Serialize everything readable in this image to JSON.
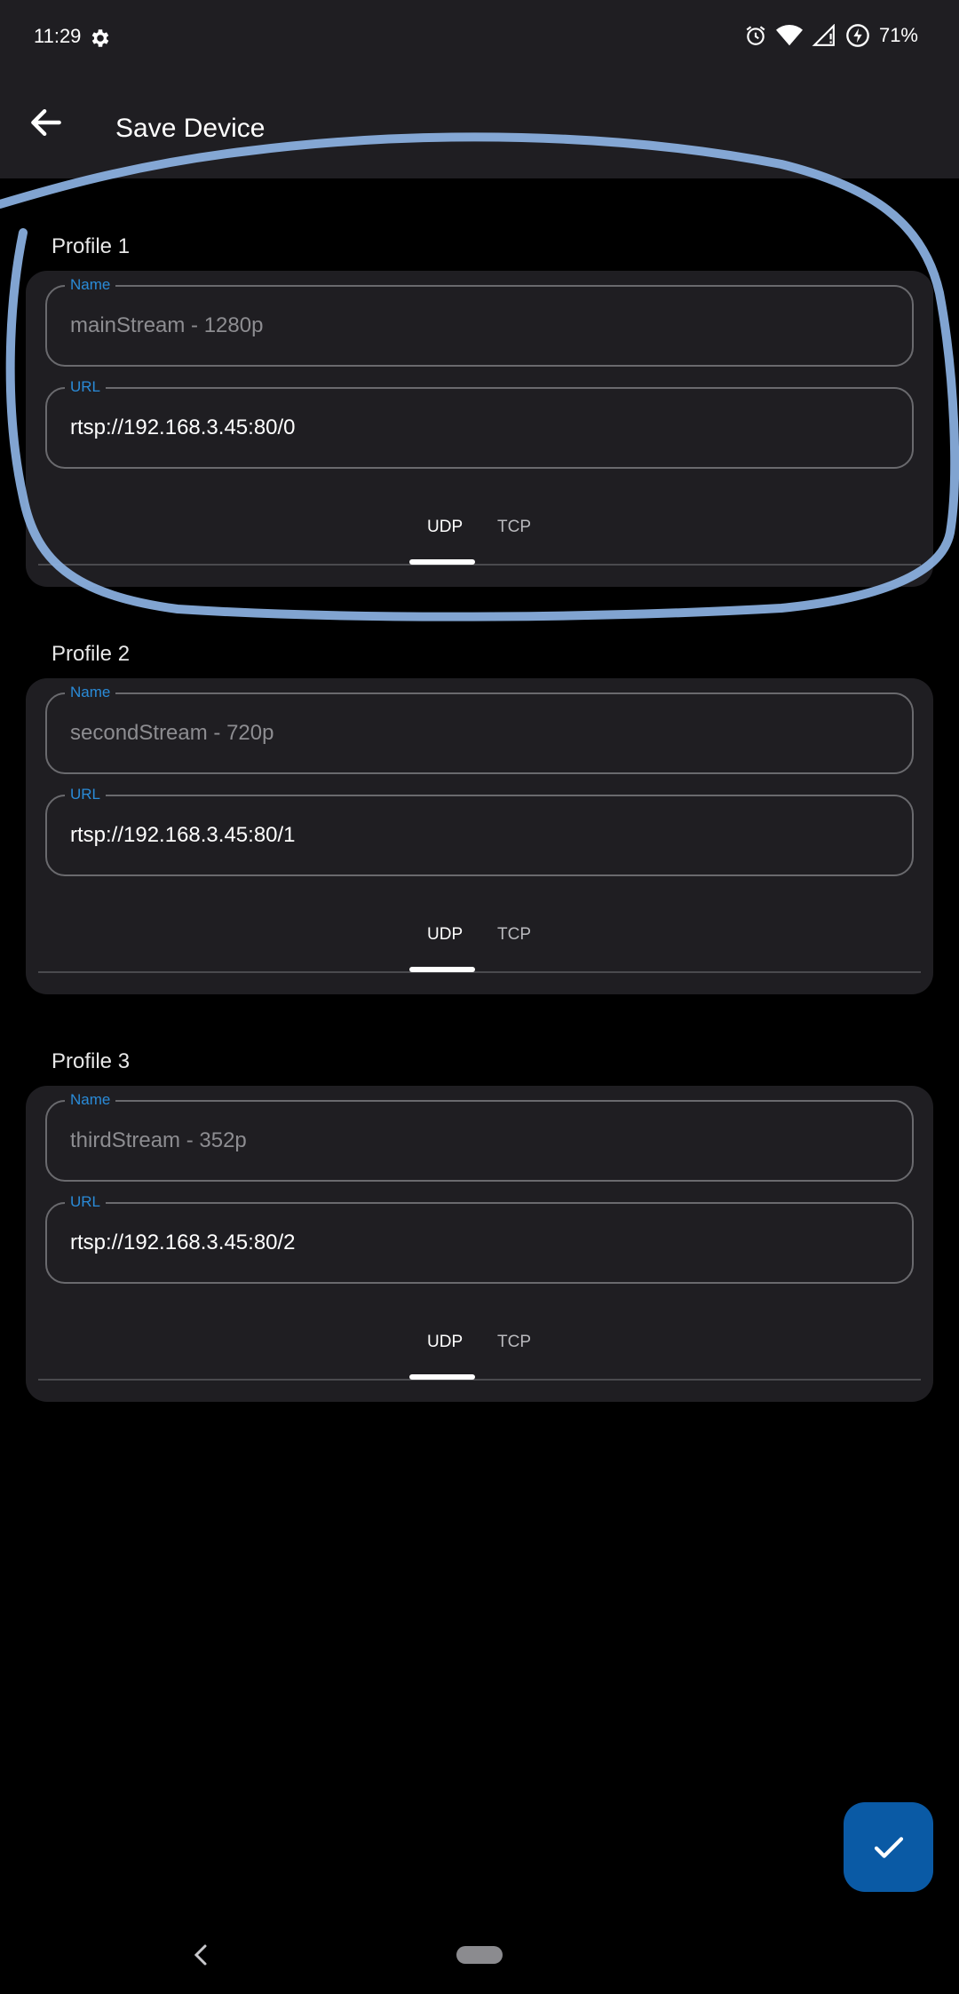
{
  "status_bar": {
    "time": "11:29",
    "battery": "71%",
    "icons": [
      "gear-icon",
      "alarm-icon",
      "wifi-icon",
      "signal-icon",
      "battery-saver-icon"
    ]
  },
  "app_bar": {
    "title": "Save Device",
    "back_icon": "arrow-left-icon"
  },
  "profiles": [
    {
      "label": "Profile 1",
      "name_label": "Name",
      "name_value": "mainStream - 1280p",
      "url_label": "URL",
      "url_value": "rtsp://192.168.3.45:80/0",
      "tabs": [
        "UDP",
        "TCP"
      ],
      "selected_tab": "UDP"
    },
    {
      "label": "Profile 2",
      "name_label": "Name",
      "name_value": "secondStream - 720p",
      "url_label": "URL",
      "url_value": "rtsp://192.168.3.45:80/1",
      "tabs": [
        "UDP",
        "TCP"
      ],
      "selected_tab": "UDP"
    },
    {
      "label": "Profile 3",
      "name_label": "Name",
      "name_value": "thirdStream - 352p",
      "url_label": "URL",
      "url_value": "rtsp://192.168.3.45:80/2",
      "tabs": [
        "UDP",
        "TCP"
      ],
      "selected_tab": "UDP"
    }
  ],
  "fab": {
    "icon": "check-icon"
  },
  "colors": {
    "accent": "#2a8bd8",
    "fab": "#0a5aa5",
    "surface": "#1f1e22",
    "annotation": "#8fb6e8"
  }
}
